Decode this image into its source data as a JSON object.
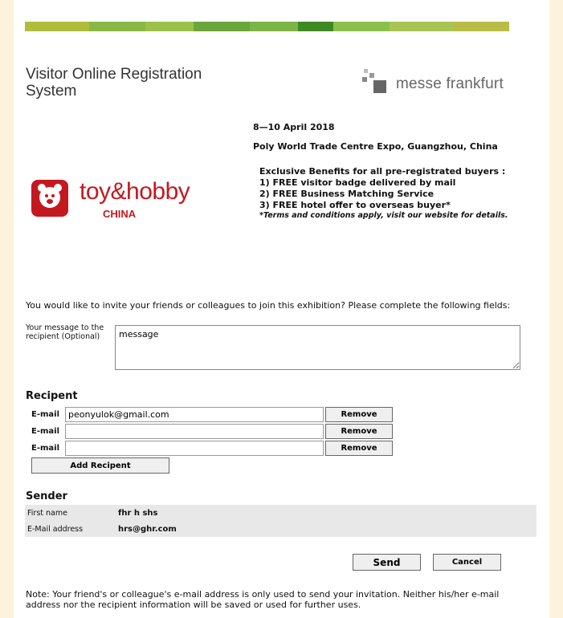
{
  "header": {
    "title": "Visitor Online Registration System",
    "brand_name": "messe frankfurt"
  },
  "event": {
    "dates": "8—10 April 2018",
    "venue": "Poly World Trade Centre Expo, Guangzhou, China",
    "benefits_heading": "Exclusive Benefits for all pre-registrated buyers :",
    "benefits": [
      "1) FREE visitor badge delivered by mail",
      "2) FREE Business Matching Service",
      "3) FREE hotel offer to overseas buyer*"
    ],
    "terms": "*Terms and conditions apply, visit our website for details.",
    "logo_name": "toy&hobby",
    "logo_sub": "CHINA"
  },
  "invite": {
    "intro": "You would like to invite your friends or colleagues to join this exhibition? Please complete the following fields:",
    "message_label": "Your message to the recipient (Optional)",
    "message_value": "message"
  },
  "recipient": {
    "heading": "Recipent",
    "email_label": "E-mail",
    "rows": [
      {
        "value": "peonyulok@gmail.com"
      },
      {
        "value": ""
      },
      {
        "value": ""
      }
    ],
    "remove_label": "Remove",
    "add_label": "Add Recipent"
  },
  "sender": {
    "heading": "Sender",
    "first_name_label": "First name",
    "first_name_value": "fhr h shs",
    "email_label": "E-Mail address",
    "email_value": "hrs@ghr.com"
  },
  "actions": {
    "send_label": "Send",
    "cancel_label": "Cancel"
  },
  "note": "Note: Your friend's or colleague's e-mail address is only used to send your invitation. Neither his/her e-mail address nor the recipient information will be saved or used for further uses.",
  "colors": {
    "band": [
      "#a8bd3a",
      "#7fb24a",
      "#5e9b3a",
      "#8cbf4d",
      "#4e8c2a",
      "#a0c05a",
      "#b6c24a"
    ],
    "brand_red": "#c4181f"
  }
}
